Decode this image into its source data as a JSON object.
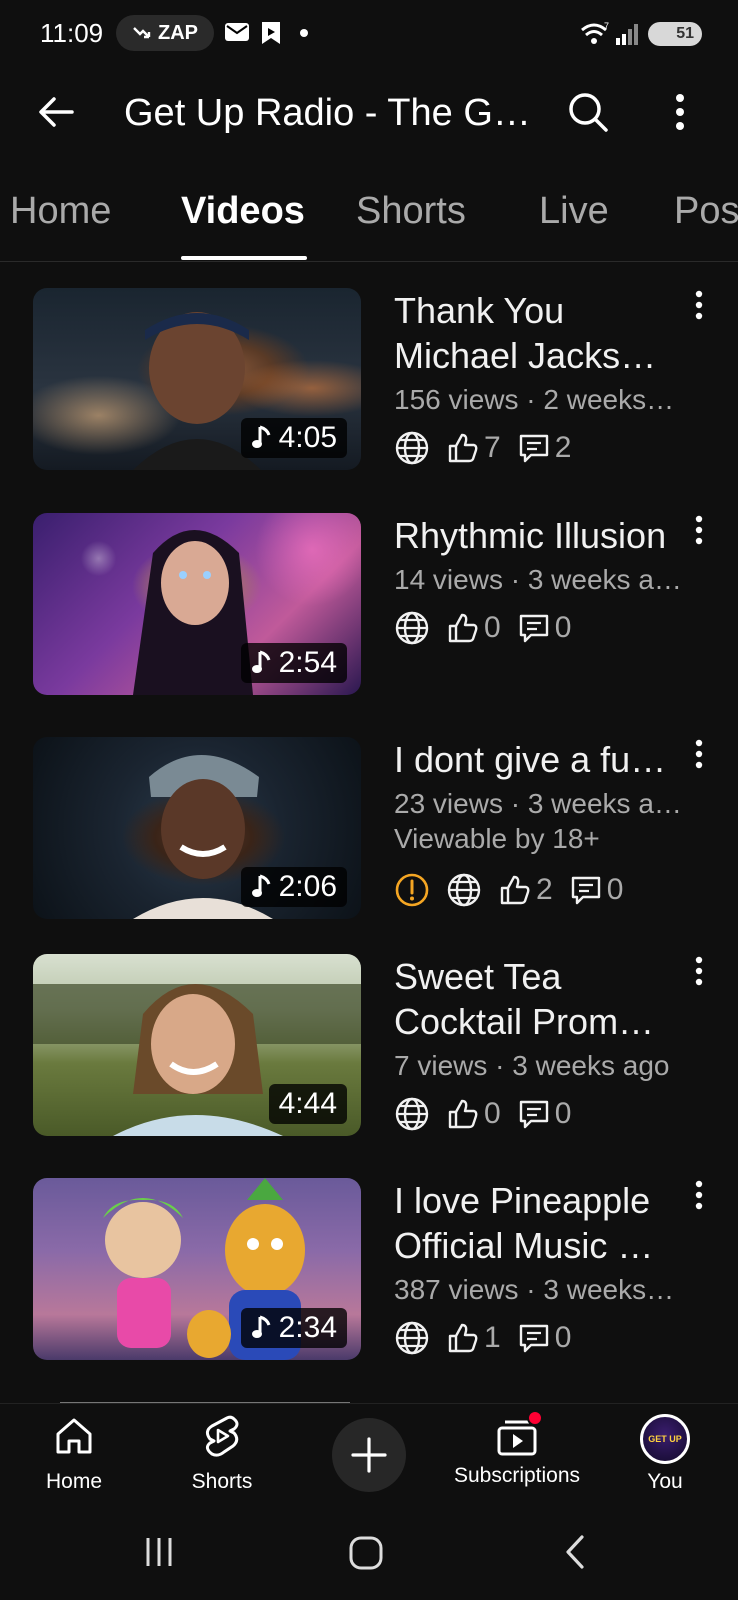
{
  "status_bar": {
    "time": "11:09",
    "carrier_badge": "ZAP",
    "battery": "51"
  },
  "header": {
    "title": "Get Up Radio - The Get Up Radio"
  },
  "tabs": [
    {
      "label": "Home"
    },
    {
      "label": "Videos"
    },
    {
      "label": "Shorts"
    },
    {
      "label": "Live"
    },
    {
      "label": "Posts"
    }
  ],
  "videos": [
    {
      "title": "Thank You Michael Jacks…",
      "meta": "156 views · 2 weeks…",
      "duration": "4:05",
      "music": true,
      "likes": "7",
      "comments": "2"
    },
    {
      "title": "Rhythmic Illusion",
      "meta": "14 views · 3 weeks a…",
      "duration": "2:54",
      "music": true,
      "likes": "0",
      "comments": "0"
    },
    {
      "title": "I dont give a fu…",
      "meta": "23 views · 3 weeks a…",
      "restriction": "Viewable by 18+",
      "duration": "2:06",
      "music": true,
      "likes": "2",
      "comments": "0"
    },
    {
      "title": "Sweet Tea Cocktail Prom…",
      "meta": "7 views · 3 weeks ago",
      "duration": "4:44",
      "music": false,
      "likes": "0",
      "comments": "0"
    },
    {
      "title": "I love Pineapple Official Music …",
      "meta": "387 views · 3 weeks…",
      "duration": "2:34",
      "music": true,
      "likes": "1",
      "comments": "0"
    }
  ],
  "bottom_nav": {
    "home": "Home",
    "shorts": "Shorts",
    "subscriptions": "Subscriptions",
    "you": "You",
    "avatar_text": "GET UP"
  },
  "colors": {
    "background": "#0f0f0f",
    "warning": "#f5a623",
    "notification": "#ff0033"
  }
}
